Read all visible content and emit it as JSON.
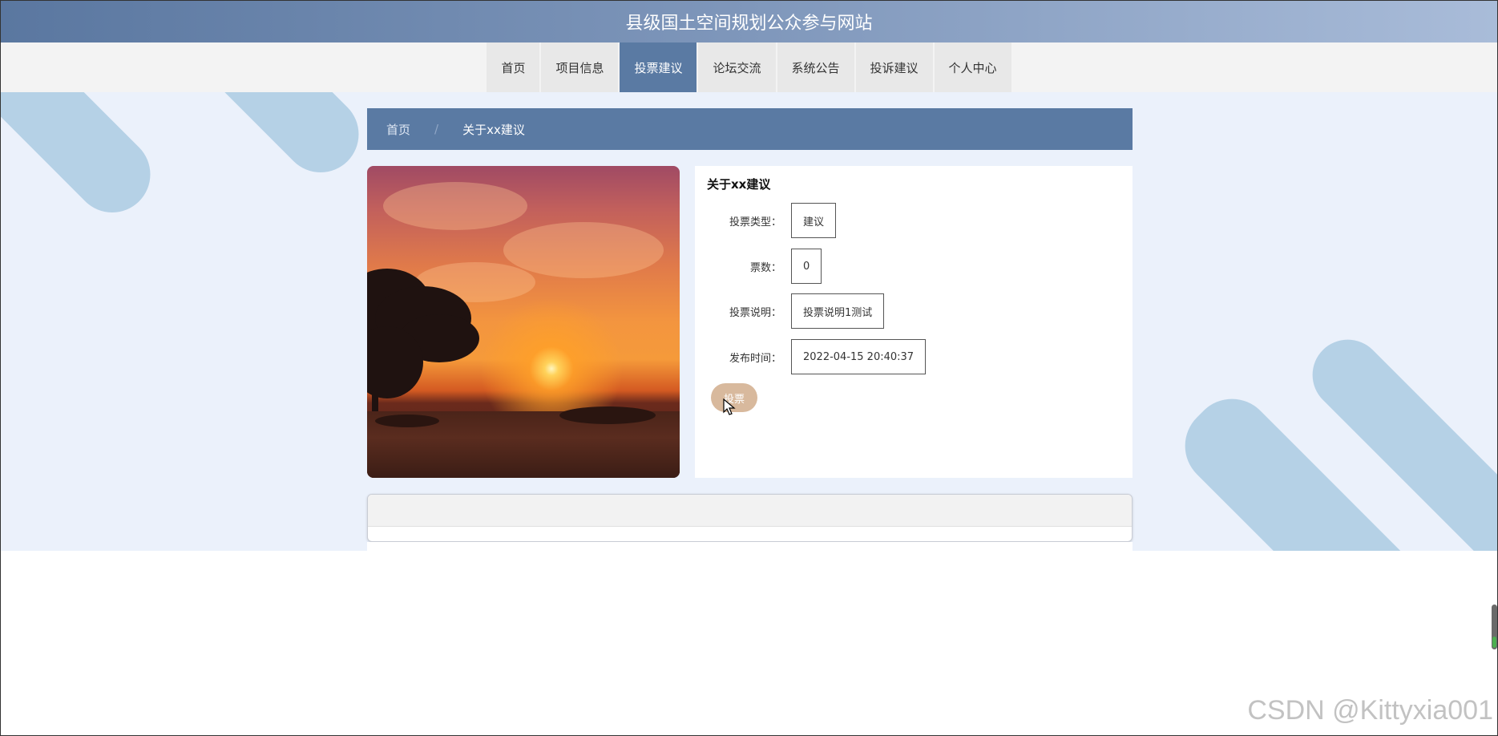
{
  "header": {
    "title": "县级国土空间规划公众参与网站"
  },
  "nav": {
    "items": [
      {
        "label": "首页"
      },
      {
        "label": "项目信息"
      },
      {
        "label": "投票建议"
      },
      {
        "label": "论坛交流"
      },
      {
        "label": "系统公告"
      },
      {
        "label": "投诉建议"
      },
      {
        "label": "个人中心"
      }
    ],
    "active_index": 2
  },
  "breadcrumb": {
    "home": "首页",
    "separator": "/",
    "current": "关于xx建议"
  },
  "detail": {
    "title": "关于xx建议",
    "fields": [
      {
        "label": "投票类型：",
        "value": "建议"
      },
      {
        "label": "票数：",
        "value": "0"
      },
      {
        "label": "投票说明：",
        "value": "投票说明1测试"
      },
      {
        "label": "发布时间：",
        "value": "2022-04-15 20:40:37"
      }
    ],
    "vote_button": "投票"
  },
  "watermark": "CSDN @Kittyxia001",
  "colors": {
    "header_start": "#5a77a0",
    "nav_active": "#5a7aa3",
    "vote_button": "#d8b99d",
    "page_bg": "#ebf1fb"
  }
}
